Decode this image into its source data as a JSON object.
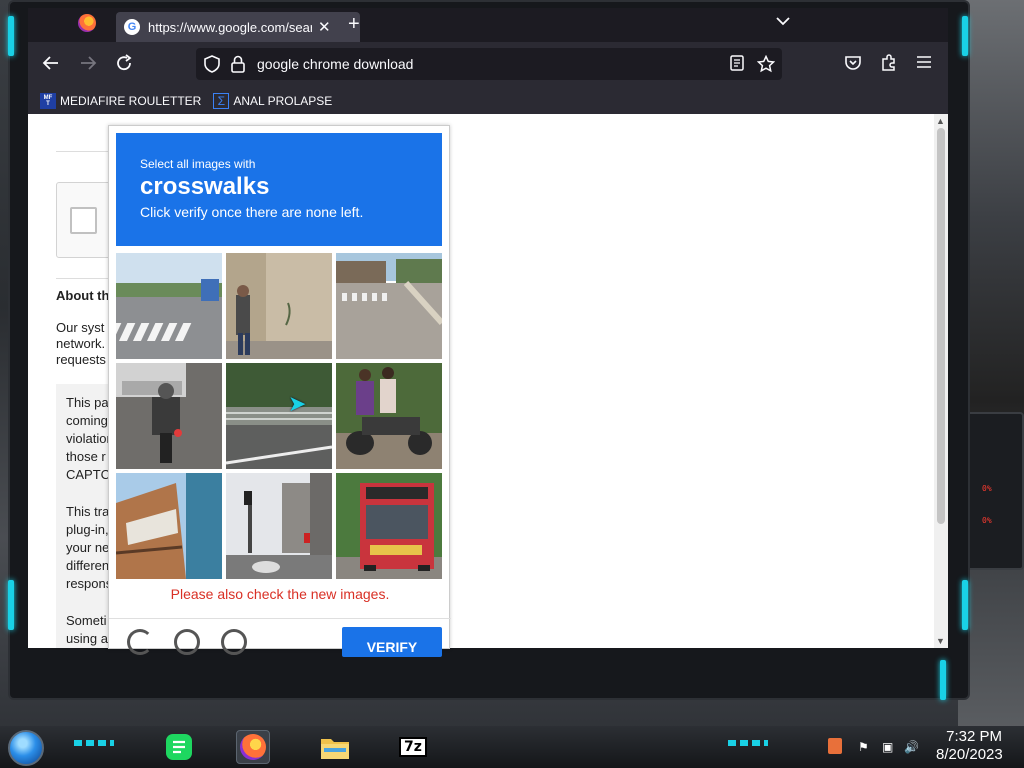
{
  "browser": {
    "tab_title": "https://www.google.com/search",
    "tab_close": "✕",
    "new_tab": "+",
    "url": "google chrome download",
    "bookmarks": [
      {
        "label": "MEDIAFIRE ROULETTER",
        "icon": "mediafire-icon"
      },
      {
        "label": "ANAL PROLAPSE",
        "icon": "sigma-icon"
      }
    ]
  },
  "page": {
    "about_title": "About th",
    "about_lines": [
      "Our syst",
      "network.",
      "requests"
    ],
    "grey_lines_1": [
      "This pa",
      "coming",
      "violation",
      "those r",
      "CAPTC"
    ],
    "grey_lines_2": [
      "This tra",
      "plug-in,",
      "your ne",
      "differen",
      "respons"
    ],
    "grey_lines_3": [
      "Someti",
      "using a"
    ]
  },
  "captcha": {
    "line1": "Select all images with",
    "keyword": "crosswalks",
    "line3": "Click verify once there are none left.",
    "new_images_msg": "Please also check the new images.",
    "verify_label": "VERIFY",
    "tiles": [
      "crosswalk-street",
      "pedestrian-wall",
      "street-crosswalk",
      "motorcycle-car",
      "road-guardrail",
      "scooter-riders",
      "building-corner",
      "street-traffic-lights",
      "red-bus"
    ]
  },
  "desktop": {
    "readouts": [
      "0%",
      "0%"
    ]
  },
  "taskbar": {
    "time": "7:32 PM",
    "date": "8/20/2023",
    "sevenzip_label": "7z"
  },
  "colors": {
    "recaptcha_blue": "#1a73e8",
    "error_red": "#d93025",
    "accent_teal": "#19d1e6"
  }
}
